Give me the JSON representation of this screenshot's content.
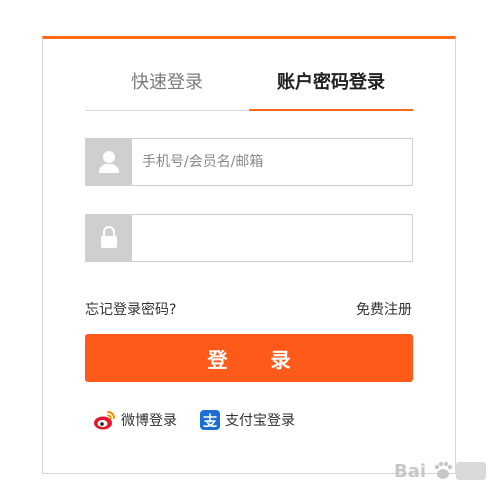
{
  "tabs": {
    "quick_login": "快速登录",
    "account_login": "账户密码登录",
    "active": "account_login"
  },
  "username": {
    "placeholder": "手机号/会员名/邮箱",
    "value": ""
  },
  "password": {
    "placeholder": "",
    "value": ""
  },
  "links": {
    "forgot_password": "忘记登录密码?",
    "register": "免费注册"
  },
  "login_button": "登 录",
  "social": [
    {
      "label": "微博登录",
      "icon": "weibo-icon"
    },
    {
      "label": "支付宝登录",
      "icon": "alipay-icon"
    }
  ],
  "colors": {
    "accent": "#ff6a13",
    "button": "#ff5a1a",
    "icon_box": "#cfcfcf",
    "border": "#d6d6d6",
    "weibo": "#e6162d",
    "alipay": "#1a6fd1"
  }
}
